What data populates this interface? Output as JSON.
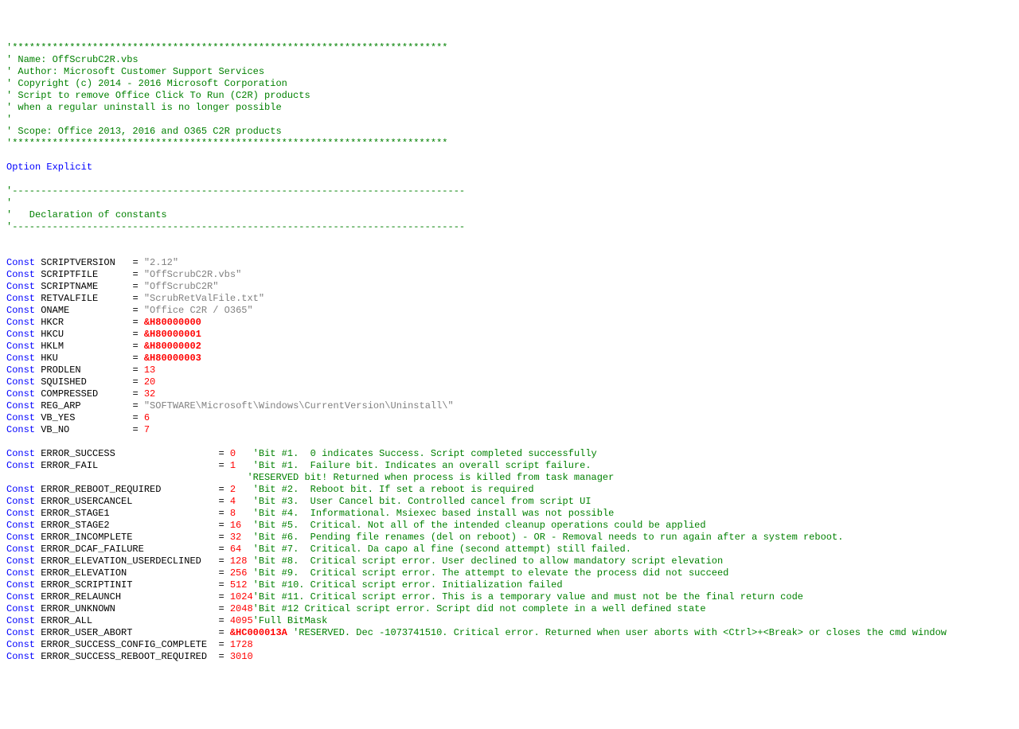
{
  "header": {
    "stars": "'****************************************************************************",
    "name_line": "' Name: OffScrubC2R.vbs",
    "author_line": "' Author: Microsoft Customer Support Services",
    "copyright_line": "' Copyright (c) 2014 - 2016 Microsoft Corporation",
    "desc_line1": "' Script to remove Office Click To Run (C2R) products",
    "desc_line2": "' when a regular uninstall is no longer possible",
    "blank_comment": "'",
    "scope_line": "' Scope: Office 2013, 2016 and O365 C2R products"
  },
  "option_explicit": "Option Explicit",
  "block": {
    "dashes": "'-------------------------------------------------------------------------------",
    "apos": "'",
    "decl_title": "'   Declaration of constants"
  },
  "kw": {
    "const": "Const"
  },
  "consts1": [
    {
      "name": " SCRIPTVERSION   ",
      "eq": "= ",
      "val": "\"2.12\"",
      "type": "str"
    },
    {
      "name": " SCRIPTFILE      ",
      "eq": "= ",
      "val": "\"OffScrubC2R.vbs\"",
      "type": "str"
    },
    {
      "name": " SCRIPTNAME      ",
      "eq": "= ",
      "val": "\"OffScrubC2R\"",
      "type": "str"
    },
    {
      "name": " RETVALFILE      ",
      "eq": "= ",
      "val": "\"ScrubRetValFile.txt\"",
      "type": "str"
    },
    {
      "name": " ONAME           ",
      "eq": "= ",
      "val": "\"Office C2R / O365\"",
      "type": "str"
    },
    {
      "name": " HKCR            ",
      "eq": "= ",
      "val": "&H80000000",
      "type": "hex"
    },
    {
      "name": " HKCU            ",
      "eq": "= ",
      "val": "&H80000001",
      "type": "hex"
    },
    {
      "name": " HKLM            ",
      "eq": "= ",
      "val": "&H80000002",
      "type": "hex"
    },
    {
      "name": " HKU             ",
      "eq": "= ",
      "val": "&H80000003",
      "type": "hex"
    },
    {
      "name": " PRODLEN         ",
      "eq": "= ",
      "val": "13",
      "type": "num"
    },
    {
      "name": " SQUISHED        ",
      "eq": "= ",
      "val": "20",
      "type": "num"
    },
    {
      "name": " COMPRESSED      ",
      "eq": "= ",
      "val": "32",
      "type": "num"
    },
    {
      "name": " REG_ARP         ",
      "eq": "= ",
      "val": "\"SOFTWARE\\Microsoft\\Windows\\CurrentVersion\\Uninstall\\\"",
      "type": "str"
    },
    {
      "name": " VB_YES          ",
      "eq": "= ",
      "val": "6",
      "type": "num"
    },
    {
      "name": " VB_NO           ",
      "eq": "= ",
      "val": "7",
      "type": "num"
    }
  ],
  "consts2": [
    {
      "name": " ERROR_SUCCESS                  ",
      "eq": "= ",
      "val": "0",
      "pad": "   ",
      "comment": "'Bit #1.  0 indicates Success. Script completed successfully",
      "type": "num"
    },
    {
      "name": " ERROR_FAIL                     ",
      "eq": "= ",
      "val": "1",
      "pad": "   ",
      "comment": "'Bit #1.  Failure bit. Indicates an overall script failure.",
      "type": "num"
    }
  ],
  "reserved_line": "                                          'RESERVED bit! Returned when process is killed from task manager",
  "consts3": [
    {
      "name": " ERROR_REBOOT_REQUIRED          ",
      "eq": "= ",
      "val": "2",
      "pad": "   ",
      "comment": "'Bit #2.  Reboot bit. If set a reboot is required",
      "type": "num"
    },
    {
      "name": " ERROR_USERCANCEL               ",
      "eq": "= ",
      "val": "4",
      "pad": "   ",
      "comment": "'Bit #3.  User Cancel bit. Controlled cancel from script UI",
      "type": "num"
    },
    {
      "name": " ERROR_STAGE1                   ",
      "eq": "= ",
      "val": "8",
      "pad": "   ",
      "comment": "'Bit #4.  Informational. Msiexec based install was not possible",
      "type": "num"
    },
    {
      "name": " ERROR_STAGE2                   ",
      "eq": "= ",
      "val": "16",
      "pad": "  ",
      "comment": "'Bit #5.  Critical. Not all of the intended cleanup operations could be applied",
      "type": "num"
    },
    {
      "name": " ERROR_INCOMPLETE               ",
      "eq": "= ",
      "val": "32",
      "pad": "  ",
      "comment": "'Bit #6.  Pending file renames (del on reboot) - OR - Removal needs to run again after a system reboot.",
      "type": "num"
    },
    {
      "name": " ERROR_DCAF_FAILURE             ",
      "eq": "= ",
      "val": "64",
      "pad": "  ",
      "comment": "'Bit #7.  Critical. Da capo al fine (second attempt) still failed.",
      "type": "num"
    },
    {
      "name": " ERROR_ELEVATION_USERDECLINED   ",
      "eq": "= ",
      "val": "128",
      "pad": " ",
      "comment": "'Bit #8.  Critical script error. User declined to allow mandatory script elevation",
      "type": "num"
    },
    {
      "name": " ERROR_ELEVATION                ",
      "eq": "= ",
      "val": "256",
      "pad": " ",
      "comment": "'Bit #9.  Critical script error. The attempt to elevate the process did not succeed",
      "type": "num"
    },
    {
      "name": " ERROR_SCRIPTINIT               ",
      "eq": "= ",
      "val": "512",
      "pad": " ",
      "comment": "'Bit #10. Critical script error. Initialization failed",
      "type": "num"
    },
    {
      "name": " ERROR_RELAUNCH                 ",
      "eq": "= ",
      "val": "1024",
      "pad": "",
      "comment": "'Bit #11. Critical script error. This is a temporary value and must not be the final return code",
      "type": "num"
    },
    {
      "name": " ERROR_UNKNOWN                  ",
      "eq": "= ",
      "val": "2048",
      "pad": "",
      "comment": "'Bit #12 Critical script error. Script did not complete in a well defined state",
      "type": "num"
    },
    {
      "name": " ERROR_ALL                      ",
      "eq": "= ",
      "val": "4095",
      "pad": "",
      "comment": "'Full BitMask",
      "type": "num"
    },
    {
      "name": " ERROR_USER_ABORT               ",
      "eq": "= ",
      "val": "&HC000013A",
      "pad": " ",
      "comment": "'RESERVED. Dec -1073741510. Critical error. Returned when user aborts with <Ctrl>+<Break> or closes the cmd window",
      "type": "hex"
    },
    {
      "name": " ERROR_SUCCESS_CONFIG_COMPLETE  ",
      "eq": "= ",
      "val": "1728",
      "pad": "",
      "comment": "",
      "type": "num"
    },
    {
      "name": " ERROR_SUCCESS_REBOOT_REQUIRED  ",
      "eq": "= ",
      "val": "3010",
      "pad": "",
      "comment": "",
      "type": "num"
    }
  ]
}
